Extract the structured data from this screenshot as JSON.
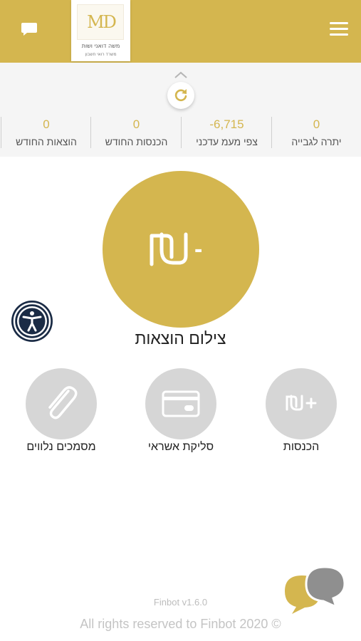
{
  "header": {
    "logo_mark": "MD",
    "logo_name": "משה דואני ושות",
    "logo_subtitle": "משרד רואי חשבון",
    "menu_icon": "hamburger-icon",
    "chat_icon": "chat-icon"
  },
  "summary": {
    "stats": [
      {
        "value": "0",
        "label": "יתרה לגבייה"
      },
      {
        "value": "-6,715",
        "label": "צפי מעמ עדכני"
      },
      {
        "value": "0",
        "label": "הכנסות החודש"
      },
      {
        "value": "0",
        "label": "הוצאות החודש"
      }
    ]
  },
  "main_action": {
    "icon_text": "-",
    "label": "צילום הוצאות"
  },
  "actions": [
    {
      "label": "הכנסות",
      "icon": "shekel-plus-icon"
    },
    {
      "label": "סליקת אשראי",
      "icon": "credit-card-icon"
    },
    {
      "label": "מסמכים נלווים",
      "icon": "paperclip-icon"
    }
  ],
  "footer": {
    "version": "Finbot v1.6.0",
    "rights": "All rights reserved to Finbot 2020 ©"
  },
  "colors": {
    "brand_gold": "#d4b64f",
    "action_gray": "#d6d6d6",
    "accessibility_navy": "#1a2b45"
  }
}
